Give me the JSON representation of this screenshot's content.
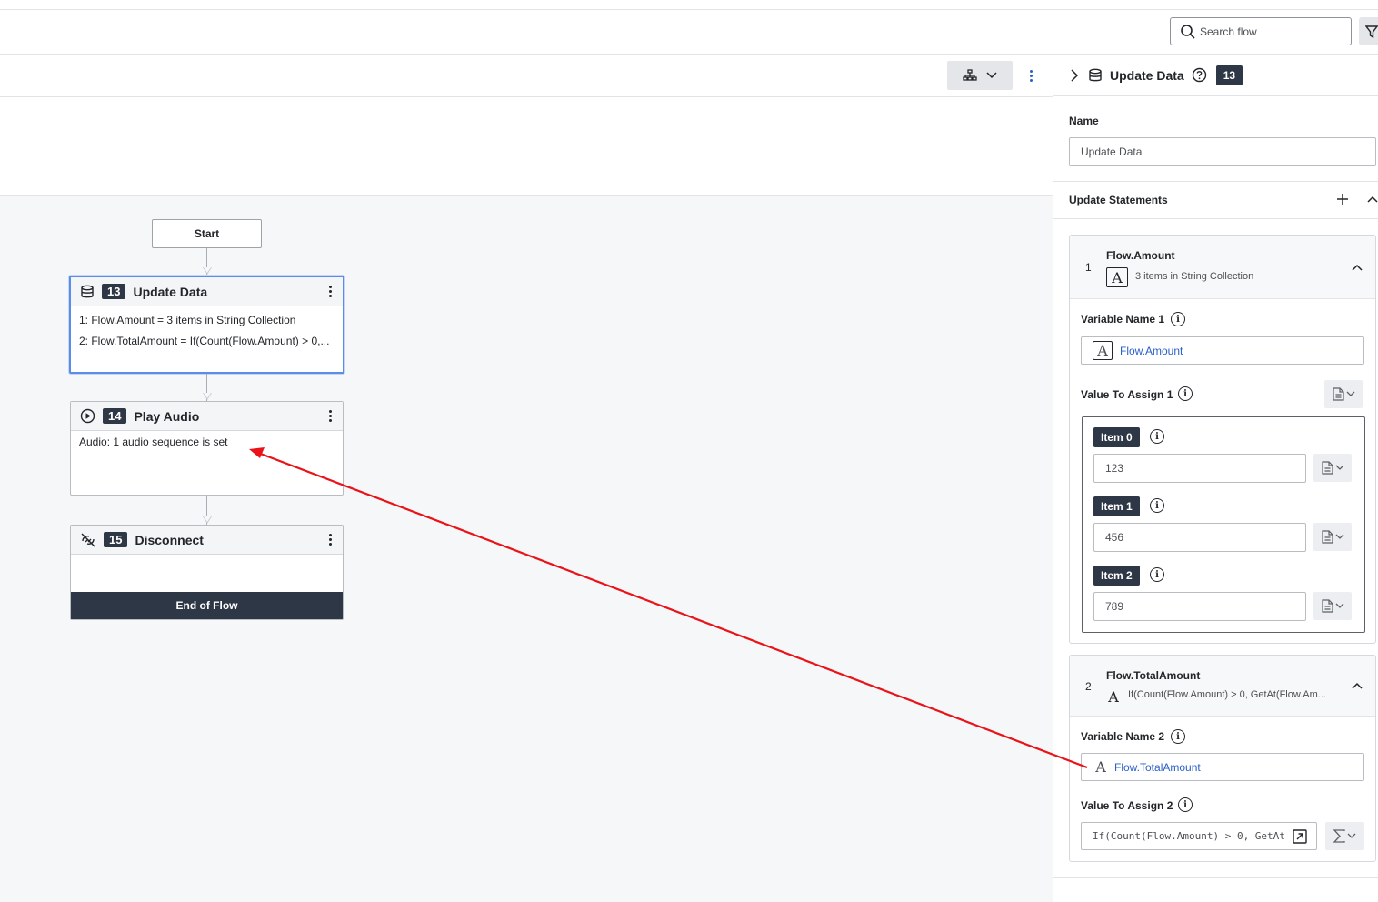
{
  "search": {
    "placeholder": "Search flow"
  },
  "flow": {
    "start_label": "Start",
    "nodes": [
      {
        "num": "13",
        "title": "Update Data",
        "lines": [
          "1: Flow.Amount = 3 items in String Collection",
          "2: Flow.TotalAmount = If(Count(Flow.Amount) > 0,..."
        ]
      },
      {
        "num": "14",
        "title": "Play Audio",
        "lines": [
          "Audio: 1 audio sequence is set"
        ]
      },
      {
        "num": "15",
        "title": "Disconnect",
        "lines": []
      }
    ],
    "end_label": "End of Flow"
  },
  "panel": {
    "title": "Update Data",
    "num": "13",
    "name_label": "Name",
    "name_value": "Update Data",
    "statements_label": "Update Statements",
    "statements": [
      {
        "index": "1",
        "name": "Flow.Amount",
        "summary": "3 items in String Collection",
        "var_label": "Variable Name 1",
        "var_value": "Flow.Amount",
        "assign_label": "Value To Assign 1",
        "items": [
          {
            "label": "Item 0",
            "value": "123"
          },
          {
            "label": "Item 1",
            "value": "456"
          },
          {
            "label": "Item 2",
            "value": "789"
          }
        ]
      },
      {
        "index": "2",
        "name": "Flow.TotalAmount",
        "summary": "If(Count(Flow.Amount) > 0, GetAt(Flow.Am...",
        "var_label": "Variable Name 2",
        "var_value": "Flow.TotalAmount",
        "assign_label": "Value To Assign 2",
        "expression": "If(Count(Flow.Amount) > 0, GetAt("
      }
    ]
  },
  "colors": {
    "accent": "#2a60c8",
    "dark": "#2e3745",
    "annotation": "#e8141a"
  }
}
